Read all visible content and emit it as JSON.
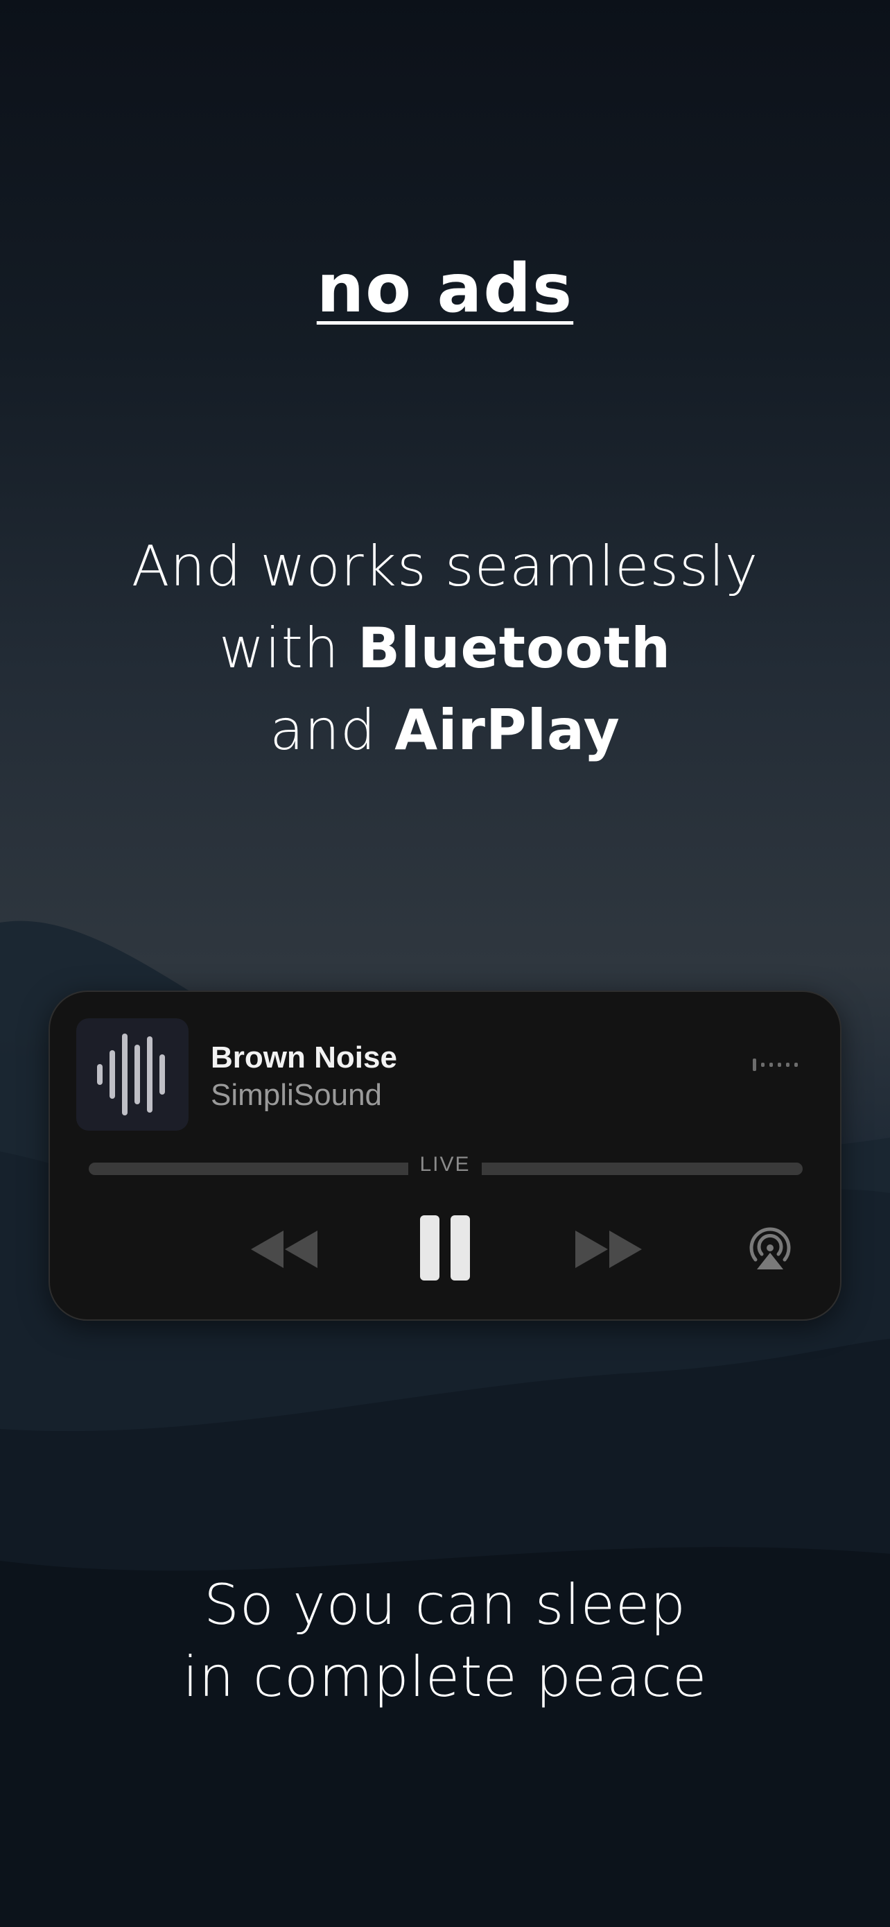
{
  "headline": "no ads",
  "subhead": {
    "line1": "And works seamlessly",
    "line2_prefix": "with ",
    "line2_bold": "Bluetooth",
    "line3_prefix": "and ",
    "line3_bold": "AirPlay"
  },
  "player": {
    "title": "Brown Noise",
    "artist": "SimpliSound",
    "live_label": "LIVE",
    "controls": {
      "rewind_icon": "backward-icon",
      "pause_icon": "pause-icon",
      "forward_icon": "forward-icon",
      "airplay_icon": "airplay-icon"
    }
  },
  "footer": {
    "line1": "So you can sleep",
    "line2": "in complete peace"
  },
  "colors": {
    "background_top": "#0c1119",
    "background_mid": "#2f373f",
    "player_bg": "#131313",
    "text": "#ffffff",
    "muted": "#9a9a9a"
  }
}
